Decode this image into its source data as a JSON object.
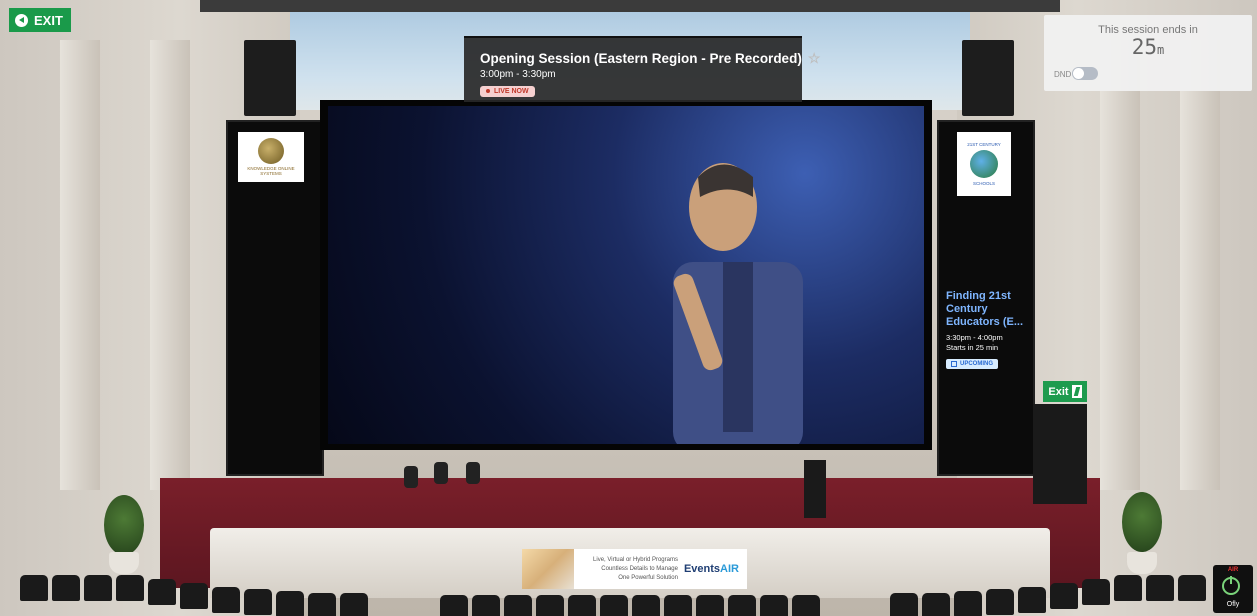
{
  "exit_button": {
    "label": "EXIT"
  },
  "session": {
    "title": "Opening Session (Eastern Region - Pre Recorded)",
    "time": "3:00pm - 3:30pm",
    "status": "LIVE NOW"
  },
  "timer": {
    "label": "This session ends in",
    "value": "25",
    "unit": "m",
    "dnd_label": "DND",
    "dnd_on": false
  },
  "sponsors": {
    "left": {
      "line1": "KNOWLEDGE ONLINE",
      "line2": "SYSTEMS"
    },
    "right": {
      "line1": "21ST CENTURY",
      "line2": "SCHOOLS"
    }
  },
  "upcoming": {
    "title": "Finding 21st Century Educators (E...",
    "time": "3:30pm - 4:00pm",
    "starts": "Starts in 25 min",
    "badge": "UPCOMING"
  },
  "exit_sign": {
    "label": "Exit"
  },
  "ad": {
    "line1": "Live, Virtual or Hybrid Programs",
    "line2": "Countless Details to Manage",
    "line3": "One Powerful Solution",
    "brand_a": "Events",
    "brand_b": "AIR"
  },
  "corner_badge": {
    "brand": "AIR",
    "label": "Ofly"
  },
  "colors": {
    "exit_green": "#1a9a4a",
    "live_red": "#c0392b",
    "stage_red": "#7a1f2a",
    "upcoming_blue": "#7fb6ff"
  }
}
